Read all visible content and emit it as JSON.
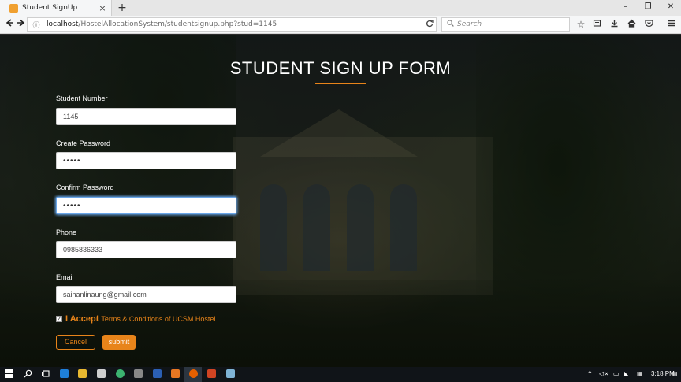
{
  "browser": {
    "tab_title": "Student SignUp",
    "tab_close": "×",
    "new_tab": "+",
    "url_host": "localhost",
    "url_path": "/HostelAllocationSystem/studentsignup.php?stud=1145",
    "search_placeholder": "Search",
    "window_controls": [
      "–",
      "❐",
      "✕"
    ]
  },
  "form": {
    "title": "STUDENT SIGN UP FORM",
    "student_number_label": "Student Number",
    "student_number_value": "1145",
    "password_label": "Create Password",
    "password_value": "•••••",
    "confirm_label": "Confirm Password",
    "confirm_value": "•••••",
    "phone_label": "Phone",
    "phone_value": "0985836333",
    "email_label": "Email",
    "email_value": "saihanlinaung@gmail.com",
    "accept_checked": "✓",
    "accept_strong": "I Accept",
    "accept_terms": "Terms & Conditions of UCSM Hostel",
    "cancel_label": "Cancel",
    "submit_label": "submit"
  },
  "taskbar": {
    "time": "3:18 PM"
  },
  "colors": {
    "accent": "#e8841a",
    "focus": "#68a8ee"
  }
}
